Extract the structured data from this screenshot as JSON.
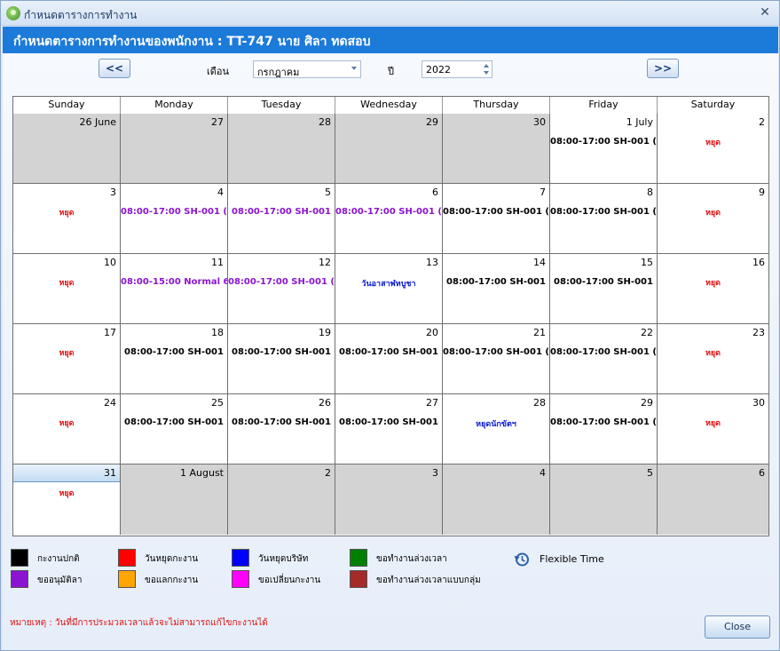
{
  "window": {
    "title": "กำหนดตารางการทำงาน"
  },
  "header": {
    "text": "กำหนดตารางการทำงานของพนักงาน  : TT-747  นาย ศิลา ทดสอบ"
  },
  "controls": {
    "prev_label": "<<",
    "next_label": ">>",
    "month_label": "เดือน",
    "month_value": "กรกฎาคม",
    "year_label": "ปี",
    "year_value": "2022"
  },
  "calendar": {
    "weekdays": [
      "Sunday",
      "Monday",
      "Tuesday",
      "Wednesday",
      "Thursday",
      "Friday",
      "Saturday"
    ],
    "weeks": [
      [
        {
          "day": "26 June",
          "out": true,
          "shift": "",
          "color": ""
        },
        {
          "day": "27",
          "out": true,
          "shift": "",
          "color": ""
        },
        {
          "day": "28",
          "out": true,
          "shift": "",
          "color": ""
        },
        {
          "day": "29",
          "out": true,
          "shift": "",
          "color": ""
        },
        {
          "day": "30",
          "out": true,
          "shift": "",
          "color": ""
        },
        {
          "day": "1 July",
          "out": false,
          "shift": "08:00-17:00 SH-001 (",
          "color": "#000000"
        },
        {
          "day": "2",
          "out": false,
          "shift": "หยุด",
          "color": "#e01010"
        }
      ],
      [
        {
          "day": "3",
          "out": false,
          "shift": "หยุด",
          "color": "#e01010"
        },
        {
          "day": "4",
          "out": false,
          "shift": "08:00-17:00 SH-001 (",
          "color": "#8a14d0"
        },
        {
          "day": "5",
          "out": false,
          "shift": "08:00-17:00 SH-001",
          "color": "#8a14d0"
        },
        {
          "day": "6",
          "out": false,
          "shift": "08:00-17:00 SH-001 (",
          "color": "#8a14d0"
        },
        {
          "day": "7",
          "out": false,
          "shift": "08:00-17:00 SH-001 (",
          "color": "#000000"
        },
        {
          "day": "8",
          "out": false,
          "shift": "08:00-17:00 SH-001 (",
          "color": "#000000"
        },
        {
          "day": "9",
          "out": false,
          "shift": "หยุด",
          "color": "#e01010"
        }
      ],
      [
        {
          "day": "10",
          "out": false,
          "shift": "หยุด",
          "color": "#e01010"
        },
        {
          "day": "11",
          "out": false,
          "shift": "08:00-15:00 Normal 6",
          "color": "#8a14d0"
        },
        {
          "day": "12",
          "out": false,
          "shift": "08:00-17:00 SH-001 (",
          "color": "#8a14d0"
        },
        {
          "day": "13",
          "out": false,
          "shift": "วันอาสาฬหบูชา",
          "color": "#0a1ad0"
        },
        {
          "day": "14",
          "out": false,
          "shift": "08:00-17:00 SH-001",
          "color": "#000000"
        },
        {
          "day": "15",
          "out": false,
          "shift": "08:00-17:00 SH-001",
          "color": "#000000"
        },
        {
          "day": "16",
          "out": false,
          "shift": "หยุด",
          "color": "#e01010"
        }
      ],
      [
        {
          "day": "17",
          "out": false,
          "shift": "หยุด",
          "color": "#e01010"
        },
        {
          "day": "18",
          "out": false,
          "shift": "08:00-17:00 SH-001",
          "color": "#000000"
        },
        {
          "day": "19",
          "out": false,
          "shift": "08:00-17:00 SH-001",
          "color": "#000000"
        },
        {
          "day": "20",
          "out": false,
          "shift": "08:00-17:00 SH-001",
          "color": "#000000"
        },
        {
          "day": "21",
          "out": false,
          "shift": "08:00-17:00 SH-001 (",
          "color": "#000000"
        },
        {
          "day": "22",
          "out": false,
          "shift": "08:00-17:00 SH-001 (",
          "color": "#000000"
        },
        {
          "day": "23",
          "out": false,
          "shift": "หยุด",
          "color": "#e01010"
        }
      ],
      [
        {
          "day": "24",
          "out": false,
          "shift": "หยุด",
          "color": "#e01010"
        },
        {
          "day": "25",
          "out": false,
          "shift": "08:00-17:00 SH-001",
          "color": "#000000"
        },
        {
          "day": "26",
          "out": false,
          "shift": "08:00-17:00 SH-001",
          "color": "#000000"
        },
        {
          "day": "27",
          "out": false,
          "shift": "08:00-17:00 SH-001",
          "color": "#000000"
        },
        {
          "day": "28",
          "out": false,
          "shift": "หยุดนักขัตฯ",
          "color": "#0a1ad0"
        },
        {
          "day": "29",
          "out": false,
          "shift": "08:00-17:00 SH-001 (",
          "color": "#000000"
        },
        {
          "day": "30",
          "out": false,
          "shift": "หยุด",
          "color": "#e01010"
        }
      ],
      [
        {
          "day": "31",
          "out": false,
          "shift": "หยุด",
          "color": "#e01010",
          "today": true
        },
        {
          "day": "1 August",
          "out": true,
          "shift": "",
          "color": ""
        },
        {
          "day": "2",
          "out": true,
          "shift": "",
          "color": ""
        },
        {
          "day": "3",
          "out": true,
          "shift": "",
          "color": ""
        },
        {
          "day": "4",
          "out": true,
          "shift": "",
          "color": ""
        },
        {
          "day": "5",
          "out": true,
          "shift": "",
          "color": ""
        },
        {
          "day": "6",
          "out": true,
          "shift": "",
          "color": ""
        }
      ]
    ]
  },
  "legend": [
    {
      "label": "กะงานปกติ",
      "color": "#000000"
    },
    {
      "label": "ขออนุมัติลา",
      "color": "#8a14d0"
    },
    {
      "label": "วันหยุดกะงาน",
      "color": "#ff0000"
    },
    {
      "label": "ขอแลกกะงาน",
      "color": "#ffa500"
    },
    {
      "label": "วันหยุดบริษัท",
      "color": "#0000ff"
    },
    {
      "label": "ขอเปลี่ยนกะงาน",
      "color": "#ff00ff"
    },
    {
      "label": "ขอทำงานล่วงเวลา",
      "color": "#008000"
    },
    {
      "label": "ขอทำงานล่วงเวลาแบบกลุ่ม",
      "color": "#a52a2a"
    }
  ],
  "flexible_time_label": "Flexible Time",
  "note": "หมายเหตุ : วันที่มีการประมวลเวลาแล้วจะไม่สามารถแก้ไขกะงานได้",
  "buttons": {
    "close_label": "Close"
  }
}
